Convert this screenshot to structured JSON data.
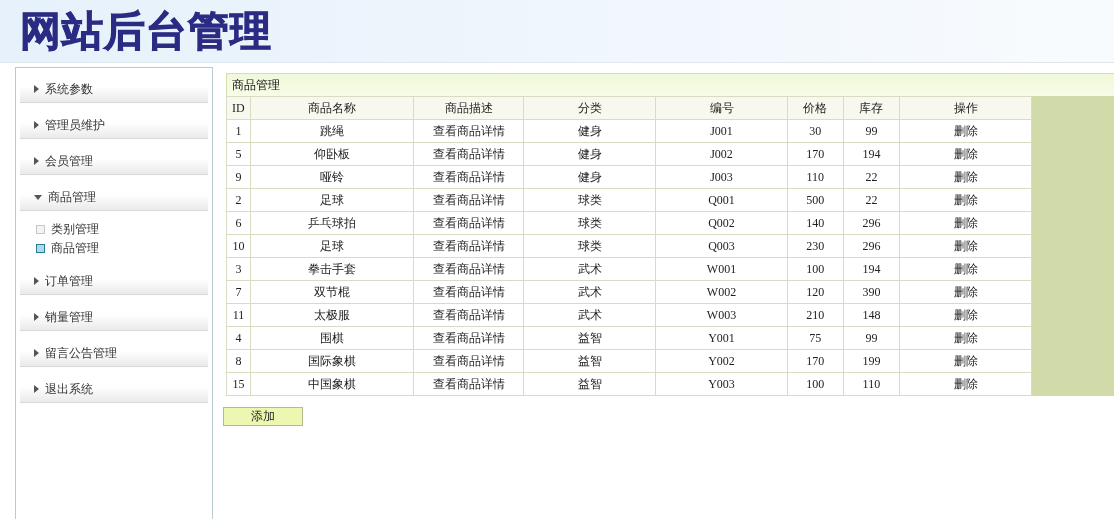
{
  "header": {
    "title": "网站后台管理"
  },
  "sidebar": {
    "items": [
      {
        "label": "系统参数",
        "expanded": false
      },
      {
        "label": "管理员维护",
        "expanded": false
      },
      {
        "label": "会员管理",
        "expanded": false
      },
      {
        "label": "商品管理",
        "expanded": true,
        "children": [
          {
            "label": "类别管理",
            "selected": false
          },
          {
            "label": "商品管理",
            "selected": true
          }
        ]
      },
      {
        "label": "订单管理",
        "expanded": false
      },
      {
        "label": "销量管理",
        "expanded": false
      },
      {
        "label": "留言公告管理",
        "expanded": false
      },
      {
        "label": "退出系统",
        "expanded": false
      }
    ]
  },
  "panel": {
    "title": "商品管理"
  },
  "table": {
    "columns": [
      "ID",
      "商品名称",
      "商品描述",
      "分类",
      "编号",
      "价格",
      "库存",
      "操作"
    ],
    "rows": [
      [
        "1",
        "跳绳",
        "查看商品详情",
        "健身",
        "J001",
        "30",
        "99",
        "删除"
      ],
      [
        "5",
        "仰卧板",
        "查看商品详情",
        "健身",
        "J002",
        "170",
        "194",
        "删除"
      ],
      [
        "9",
        "哑铃",
        "查看商品详情",
        "健身",
        "J003",
        "110",
        "22",
        "删除"
      ],
      [
        "2",
        "足球",
        "查看商品详情",
        "球类",
        "Q001",
        "500",
        "22",
        "删除"
      ],
      [
        "6",
        "乒乓球拍",
        "查看商品详情",
        "球类",
        "Q002",
        "140",
        "296",
        "删除"
      ],
      [
        "10",
        "足球",
        "查看商品详情",
        "球类",
        "Q003",
        "230",
        "296",
        "删除"
      ],
      [
        "3",
        "拳击手套",
        "查看商品详情",
        "武术",
        "W001",
        "100",
        "194",
        "删除"
      ],
      [
        "7",
        "双节棍",
        "查看商品详情",
        "武术",
        "W002",
        "120",
        "390",
        "删除"
      ],
      [
        "11",
        "太极服",
        "查看商品详情",
        "武术",
        "W003",
        "210",
        "148",
        "删除"
      ],
      [
        "4",
        "围棋",
        "查看商品详情",
        "益智",
        "Y001",
        "75",
        "99",
        "删除"
      ],
      [
        "8",
        "国际象棋",
        "查看商品详情",
        "益智",
        "Y002",
        "170",
        "199",
        "删除"
      ],
      [
        "15",
        "中国象棋",
        "查看商品详情",
        "益智",
        "Y003",
        "100",
        "110",
        "删除"
      ]
    ]
  },
  "add_button": "添加"
}
